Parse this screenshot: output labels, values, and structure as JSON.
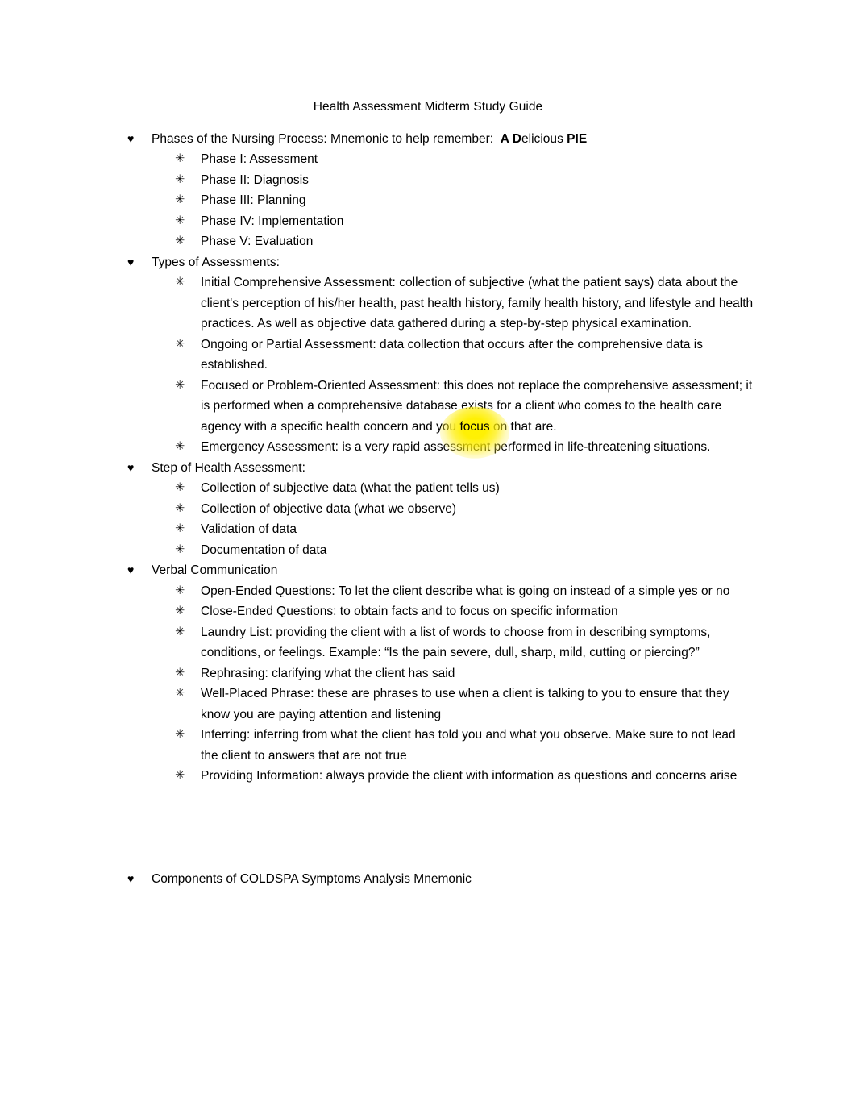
{
  "document": {
    "title": "Health Assessment Midterm Study Guide",
    "bullet_glyphs": {
      "level1": "♥",
      "level2": "✳"
    },
    "highlight_color": "#FFF200",
    "text_color": "#000000",
    "page_background": "#FFFFFF"
  },
  "sections": [
    {
      "heading_pre": "Phases of the Nursing Process: Mnemonic to help remember:  ",
      "heading_bold_a": "A D",
      "heading_mid": "elicious ",
      "heading_bold_b": "PIE",
      "items": [
        "Phase I: Assessment",
        "Phase II: Diagnosis",
        "Phase III: Planning",
        "Phase IV: Implementation",
        "Phase V: Evaluation"
      ]
    },
    {
      "heading": "Types of Assessments:",
      "items": [
        "Initial Comprehensive Assessment: collection of subjective (what the patient says) data about the client's perception of his/her health, past health history, family health history, and lifestyle and health practices. As well as objective data gathered during a step-by-step physical examination.",
        "Ongoing or Partial Assessment: data collection that occurs after the comprehensive data is established.",
        "Emergency Assessment: is a very rapid assessment performed in life-threatening situations."
      ],
      "focused_item": {
        "before_highlight": "Focused or Problem-Oriented Assessment: this does not replace the comprehensive assessment; it is performed when a comprehensive database exists for a client who comes to the health care agency with a specific health concern and you ",
        "highlighted": "focus",
        "after_highlight": " on that are."
      }
    },
    {
      "heading": "Step of Health Assessment:",
      "items": [
        "Collection of subjective data (what the patient tells us)",
        "Collection of objective data (what we observe)",
        "Validation of data",
        "Documentation of data"
      ]
    },
    {
      "heading": "Verbal Communication",
      "items": [
        "Open-Ended Questions: To let the client describe what is going on instead of a simple yes or no",
        "Close-Ended Questions: to obtain facts and to focus on specific information",
        "Laundry List: providing the client with a list of words to choose from in describing symptoms, conditions, or feelings. Example: “Is the pain severe, dull, sharp, mild, cutting or piercing?”",
        "Rephrasing: clarifying what the client has said",
        "Well-Placed Phrase: these are phrases to use when a client is talking to you to ensure that they know you are paying attention and listening",
        "Inferring: inferring from what the client has told you and what you observe. Make sure to not lead the client to answers that are not true",
        "Providing Information: always provide the client with information as questions and concerns arise"
      ]
    },
    {
      "heading": "Components of COLDSPA Symptoms Analysis Mnemonic",
      "items": []
    }
  ]
}
